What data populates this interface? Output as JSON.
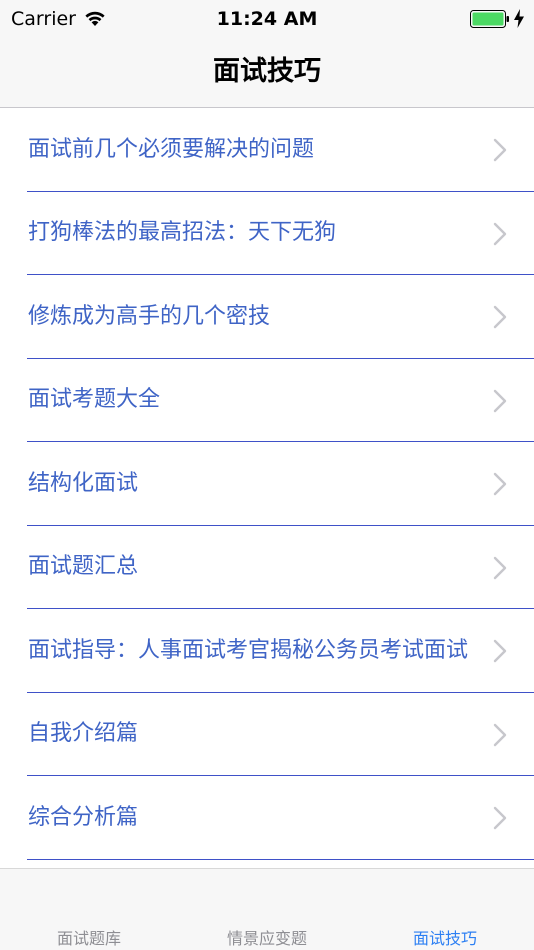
{
  "status_bar": {
    "carrier": "Carrier",
    "time": "11:24 AM",
    "battery_color": "#4cd964"
  },
  "nav": {
    "title": "面试技巧"
  },
  "list": {
    "text_color": "#3f64c6",
    "separator_color": "#3f51c8",
    "items": [
      {
        "label": "面试前几个必须要解决的问题"
      },
      {
        "label": "打狗棒法的最高招法：天下无狗"
      },
      {
        "label": "修炼成为高手的几个密技"
      },
      {
        "label": "面试考题大全"
      },
      {
        "label": "结构化面试"
      },
      {
        "label": "面试题汇总"
      },
      {
        "label": "面试指导：人事面试考官揭秘公务员考试面试"
      },
      {
        "label": "自我介绍篇"
      },
      {
        "label": "综合分析篇"
      }
    ]
  },
  "tab_bar": {
    "active_color": "#2c7ff3",
    "inactive_color": "#8e8e93",
    "tabs": [
      {
        "label": "面试题库",
        "active": false
      },
      {
        "label": "情景应变题",
        "active": false
      },
      {
        "label": "面试技巧",
        "active": true
      }
    ]
  }
}
